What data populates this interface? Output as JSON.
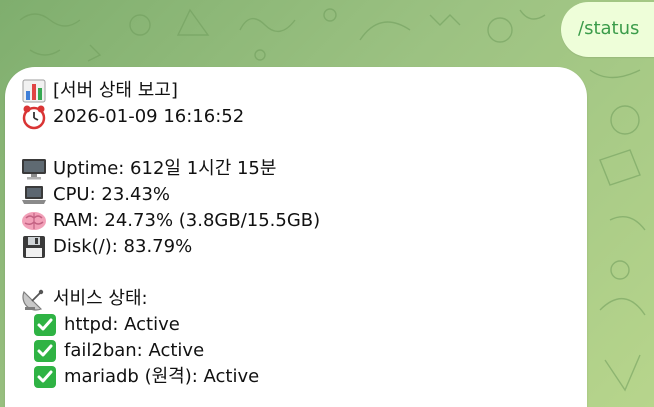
{
  "outgoing": {
    "text": "/status"
  },
  "report": {
    "title_line": {
      "icon": "bar-chart-icon",
      "text": "[서버 상태 보고]"
    },
    "timestamp_line": {
      "icon": "alarm-clock-icon",
      "text": "2026-01-09 16:16:52"
    },
    "metrics": [
      {
        "icon": "desktop-computer-icon",
        "text": "Uptime: 612일 1시간 15분"
      },
      {
        "icon": "laptop-icon",
        "text": "CPU: 23.43%"
      },
      {
        "icon": "brain-icon",
        "text": "RAM: 24.73% (3.8GB/15.5GB)"
      },
      {
        "icon": "floppy-disk-icon",
        "text": "Disk(/): 83.79%"
      }
    ],
    "services_header": {
      "icon": "satellite-dish-icon",
      "text": "서비스 상태:"
    },
    "services": [
      {
        "icon": "check-mark-icon",
        "text": "httpd: Active"
      },
      {
        "icon": "check-mark-icon",
        "text": "fail2ban: Active"
      },
      {
        "icon": "check-mark-icon",
        "text": "mariadb (원격): Active"
      }
    ]
  },
  "colors": {
    "background_start": "#7fae6e",
    "background_end": "#b7d58c",
    "outgoing_bubble": "#eefed9",
    "outgoing_text": "#3b9c4a",
    "incoming_bubble": "#ffffff",
    "check_mark": "#2fb344"
  }
}
